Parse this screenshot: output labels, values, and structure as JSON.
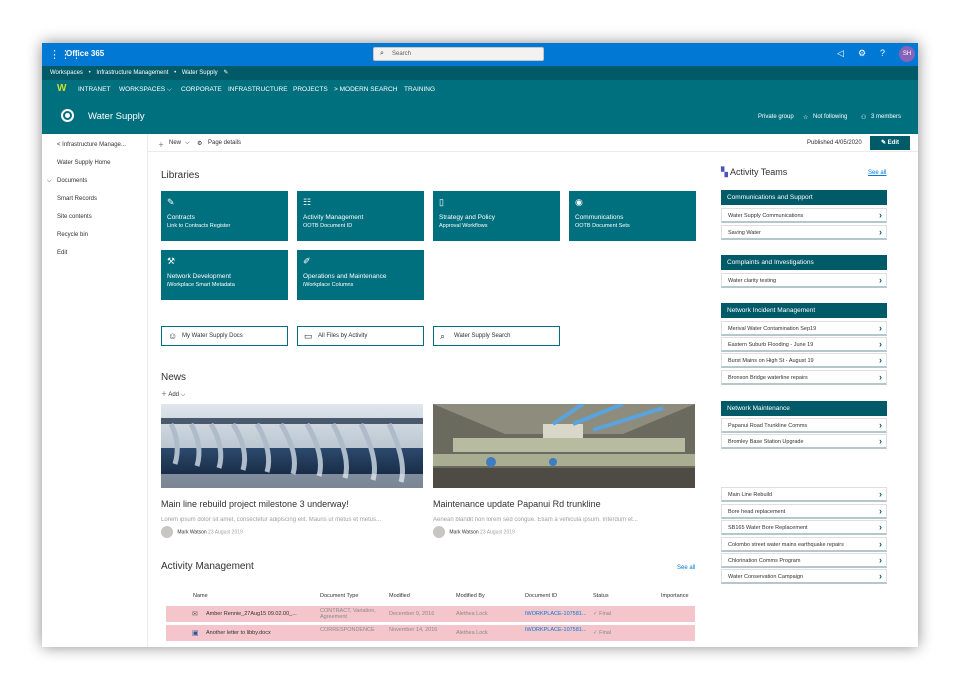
{
  "suite": {
    "app_name": "Office 365",
    "search_placeholder": "Search",
    "avatar_initials": "SH",
    "accent": "#0078d4"
  },
  "hub": {
    "items": [
      "Workspaces",
      "•",
      "Infrastructure Management",
      "•",
      "Water Supply"
    ]
  },
  "nav": {
    "logo": "W",
    "items": [
      "INTRANET",
      "WORKSPACES ⌵",
      "CORPORATE",
      "INFRASTRUCTURE",
      "PROJECTS",
      "> MODERN SEARCH",
      "TRAINING"
    ]
  },
  "site": {
    "title": "Water Supply",
    "group": "Private group",
    "follow": "Not following",
    "members": "3 members",
    "theme": "#00707f"
  },
  "leftnav": {
    "back": "< Infrastructure Manage...",
    "items": [
      "Water Supply Home",
      "Documents",
      "Smart Records",
      "Site contents",
      "Recycle bin",
      "Edit"
    ]
  },
  "command": {
    "new": "New",
    "page_details": "Page details",
    "published": "Published 4/05/2020",
    "edit": "Edit"
  },
  "libraries": {
    "title": "Libraries",
    "tiles": [
      {
        "title": "Contracts",
        "subtitle": "Link to Contracts Register",
        "icon": "✎"
      },
      {
        "title": "Activity Management",
        "subtitle": "OOTB Document ID",
        "icon": "☷"
      },
      {
        "title": "Strategy and Policy",
        "subtitle": "Approval Workflows",
        "icon": "▯"
      },
      {
        "title": "Communications",
        "subtitle": "OOTB Document Sets",
        "icon": "◉"
      },
      {
        "title": "Network Development",
        "subtitle": "iWorkplace Smart Metadata",
        "icon": "⚒"
      },
      {
        "title": "Operations and Maintenance",
        "subtitle": "iWorkplace Columns",
        "icon": "✐"
      }
    ]
  },
  "quicklinks": [
    {
      "label": "My Water Supply Docs",
      "icon": "☺"
    },
    {
      "label": "All Files by Activity",
      "icon": "▭"
    },
    {
      "label": "Water Supply Search",
      "icon": "⌕"
    }
  ],
  "news": {
    "title": "News",
    "add": "Add",
    "items": [
      {
        "title": "Main line rebuild project milestone 3 underway!",
        "excerpt": "Lorem ipsum dolor sit amet, consectetur adipiscing elit. Mauris ut metus et metus...",
        "author": "Mark Watson",
        "date": "23 August 2019"
      },
      {
        "title": "Maintenance update Papanui Rd trunkline",
        "excerpt": "Aenean blandit non lorem sed congue. Etiam a vehicula ipsum. Interdum et...",
        "author": "Mark Watson",
        "date": "23 August 2019"
      }
    ]
  },
  "activity": {
    "title": "Activity Management",
    "see_all": "See all",
    "columns": [
      "Name",
      "Document Type",
      "Modified",
      "Modified By",
      "Document ID",
      "Status",
      "Importance"
    ],
    "rows": [
      {
        "name": "Amber Rennie_27Aug15 09.02.00_...",
        "type": "CONTRACT, Variation, Agreement",
        "modified": "December 9, 2016",
        "by": "Alethea Lock",
        "docid": "IWORKPLACE-107581...",
        "status": "✓ Final"
      },
      {
        "name": "Another letter to libby.docx",
        "type": "CORRESPONDENCE",
        "modified": "November 14, 2016",
        "by": "Alethea Lock",
        "docid": "IWORKPLACE-107581...",
        "status": "✓ Final"
      }
    ],
    "row_color": "#f4c6cc"
  },
  "teams": {
    "title": "Activity Teams",
    "see_all": "See all",
    "groups": [
      {
        "name": "Communications and Support",
        "items": [
          "Water Supply Communications",
          "Saving Water"
        ]
      },
      {
        "name": "Complaints and Investigations",
        "items": [
          "Water clarity testing"
        ]
      },
      {
        "name": "Network Incident Management",
        "items": [
          "Merival Water Contamination Sep19",
          "Eastern Suburb Flooding - June 19",
          "Burst Mains on High St - August 19",
          "Bronson Bridge waterline repairs"
        ]
      },
      {
        "name": "Network Maintenance",
        "items": [
          "Papanui Road Trunkline Comms",
          "Bromley Base Station Upgrade"
        ]
      }
    ],
    "projects": [
      "Main Line Rebuild",
      "Bore head replacement",
      "SB165 Water Bore Replacement",
      "Colombo street water mains earthquake repairs",
      "Chlorination Comms Program",
      "Water Conservation Campaign"
    ]
  }
}
